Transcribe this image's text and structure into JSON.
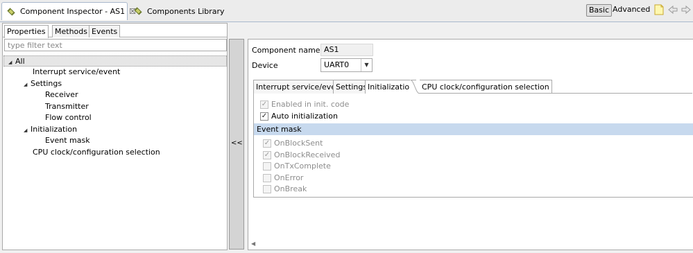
{
  "view_tabs": {
    "inspector": {
      "title": "Component Inspector - AS1",
      "close": "☒"
    },
    "library": {
      "title": "Components Library"
    }
  },
  "toolbar": {
    "basic": "Basic",
    "advanced": "Advanced"
  },
  "left": {
    "tabs": [
      "Properties",
      "Methods",
      "Events"
    ],
    "filter_placeholder": "type filter text",
    "tree": [
      {
        "label": "All"
      },
      {
        "label": "Interrupt service/event"
      },
      {
        "label": "Settings"
      },
      {
        "label": "Receiver"
      },
      {
        "label": "Transmitter"
      },
      {
        "label": "Flow control"
      },
      {
        "label": "Initialization"
      },
      {
        "label": "Event mask"
      },
      {
        "label": "CPU clock/configuration selection"
      }
    ]
  },
  "splitter": {
    "label": "<<"
  },
  "right": {
    "component_name_label": "Component name",
    "component_name_value": "AS1",
    "device_label": "Device",
    "device_value": "UART0",
    "tabs": [
      "Interrupt service/event",
      "Settings",
      "Initialization",
      "CPU clock/configuration selection"
    ],
    "enabled_label": "Enabled in init. code",
    "auto_init_label": "Auto initialization",
    "event_mask_header": "Event mask",
    "events": [
      {
        "label": "OnBlockSent",
        "checked": true
      },
      {
        "label": "OnBlockReceived",
        "checked": true
      },
      {
        "label": "OnTxComplete",
        "checked": false
      },
      {
        "label": "OnError",
        "checked": false
      },
      {
        "label": "OnBreak",
        "checked": false
      }
    ]
  },
  "colors": {
    "selection": "#c7d9ee",
    "border": "#a9a9a9"
  }
}
